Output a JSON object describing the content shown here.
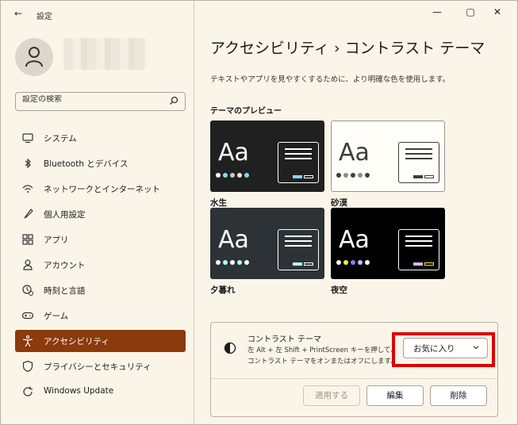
{
  "window": {
    "app_title": "設定",
    "back_glyph": "←",
    "minimize_glyph": "—",
    "maximize_glyph": "▢",
    "close_glyph": "✕"
  },
  "search": {
    "placeholder": "設定の検索"
  },
  "sidebar": {
    "items": [
      {
        "label": "システム",
        "icon": "monitor-icon"
      },
      {
        "label": "Bluetooth とデバイス",
        "icon": "bluetooth-icon"
      },
      {
        "label": "ネットワークとインターネット",
        "icon": "wifi-icon"
      },
      {
        "label": "個人用設定",
        "icon": "brush-icon"
      },
      {
        "label": "アプリ",
        "icon": "apps-icon"
      },
      {
        "label": "アカウント",
        "icon": "person-icon"
      },
      {
        "label": "時刻と言語",
        "icon": "clock-globe-icon"
      },
      {
        "label": "ゲーム",
        "icon": "gamepad-icon"
      },
      {
        "label": "アクセシビリティ",
        "icon": "accessibility-icon",
        "active": true
      },
      {
        "label": "プライバシーとセキュリティ",
        "icon": "shield-icon"
      },
      {
        "label": "Windows Update",
        "icon": "update-icon"
      }
    ],
    "accent_color": "#8b3a0c"
  },
  "main": {
    "title": "アクセシビリティ  ›  コントラスト テーマ",
    "description": "テキストやアプリを見やすくするために、より明確な色を使用します。",
    "preview_heading": "テーマのプレビュー",
    "themes": [
      {
        "name": "水生",
        "bg": "#202020",
        "fg": "#ffffff",
        "accent": "#8ad4f2",
        "dots": [
          "#ffffff",
          "#8ad4f2",
          "#c8c8c8",
          "#e8e8e8",
          "#8ad4f2"
        ]
      },
      {
        "name": "砂漠",
        "bg": "#fffef8",
        "fg": "#3d3d3d",
        "accent": "#3d3d3d",
        "dots": [
          "#3d3d3d",
          "#8c8c8c",
          "#3d3d3d",
          "#8c8c8c",
          "#3d3d3d"
        ]
      },
      {
        "name": "夕暮れ",
        "bg": "#2d3236",
        "fg": "#ffffff",
        "accent": "#b6f6f0",
        "dots": [
          "#ffffff",
          "#b6f6f0",
          "#ffffff",
          "#b6f6f0",
          "#ffffff"
        ]
      },
      {
        "name": "夜空",
        "bg": "#000000",
        "fg": "#ffffff",
        "accent": "#d6b4fd",
        "dots": [
          "#ffffff",
          "#ffee32",
          "#8080ff",
          "#d6b4fd",
          "#ffffff"
        ]
      }
    ],
    "contrast_panel": {
      "title": "コントラスト テーマ",
      "desc_line1": "左 Alt + 左 Shift + PrintScreen キーを押して、",
      "desc_line2": "コントラスト テーマをオンまたはオフにします。",
      "selected": "お気に入り",
      "apply_label": "適用する",
      "edit_label": "編集",
      "delete_label": "削除"
    }
  }
}
